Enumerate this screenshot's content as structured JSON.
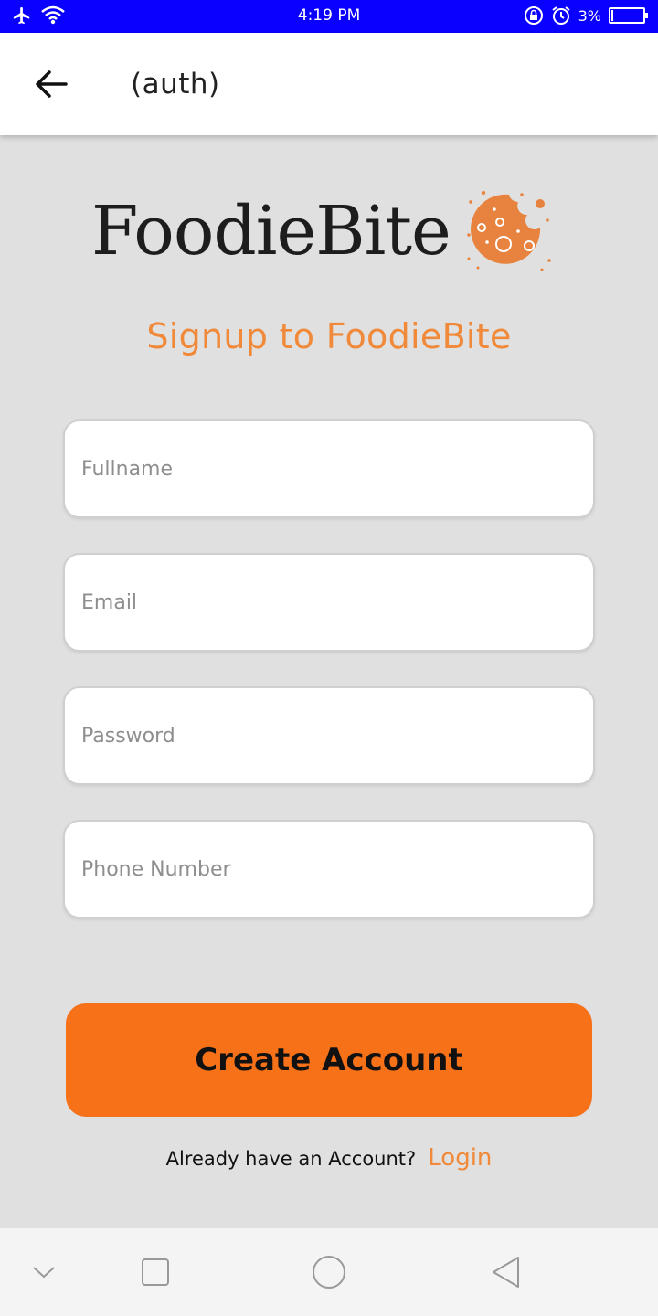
{
  "status_bar": {
    "time": "4:19 PM",
    "battery_text": "3%",
    "battery_level": 0.03,
    "icons": [
      "airplane-icon",
      "wifi-icon",
      "rotation-lock-icon",
      "alarm-icon",
      "battery-icon"
    ]
  },
  "app_bar": {
    "title": "(auth)",
    "back_icon": "back-arrow-icon"
  },
  "logo": {
    "text": "FoodieBite",
    "icon": "cookie-icon",
    "color": "#e8833f"
  },
  "headline": "Signup to FoodieBite",
  "form": {
    "fullname_placeholder": "Fullname",
    "email_placeholder": "Email",
    "password_placeholder": "Password",
    "phone_placeholder": "Phone Number"
  },
  "create_button_label": "Create Account",
  "login_prompt": {
    "question": "Already have an Account?",
    "link": "Login"
  },
  "nav_bar": {
    "icons": [
      "chevron-down-icon",
      "recents-square-icon",
      "home-circle-icon",
      "back-triangle-icon"
    ]
  },
  "colors": {
    "status_bar": "#0a00ff",
    "accent": "#f77119",
    "headline": "#f08a3a",
    "background": "#e0e0e0"
  }
}
